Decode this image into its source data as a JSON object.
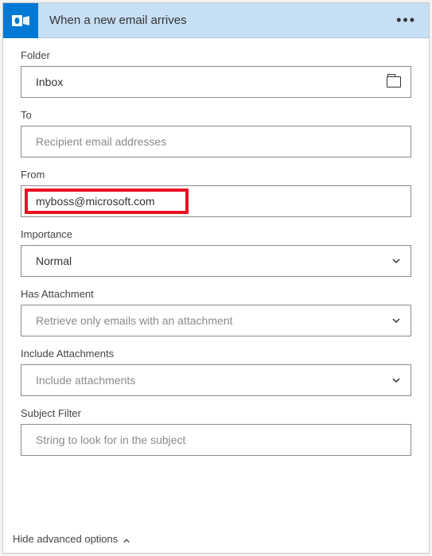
{
  "header": {
    "title": "When a new email arrives",
    "icon": "outlook-icon",
    "more": "•••"
  },
  "fields": {
    "folder": {
      "label": "Folder",
      "value": "Inbox"
    },
    "to": {
      "label": "To",
      "placeholder": "Recipient email addresses",
      "value": ""
    },
    "from": {
      "label": "From",
      "value": "myboss@microsoft.com"
    },
    "importance": {
      "label": "Importance",
      "value": "Normal"
    },
    "has_attachment": {
      "label": "Has Attachment",
      "placeholder": "Retrieve only emails with an attachment",
      "value": ""
    },
    "include_attachments": {
      "label": "Include Attachments",
      "placeholder": "Include attachments",
      "value": ""
    },
    "subject_filter": {
      "label": "Subject Filter",
      "placeholder": "String to look for in the subject",
      "value": ""
    }
  },
  "footer": {
    "toggle_label": "Hide advanced options"
  },
  "colors": {
    "header_bg": "#c7dff4",
    "brand": "#0078d4",
    "highlight": "#e81123"
  }
}
